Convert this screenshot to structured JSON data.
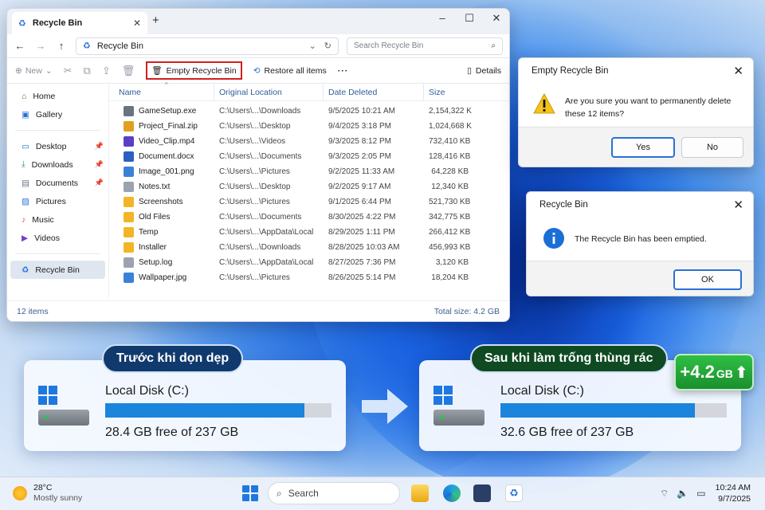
{
  "explorer": {
    "tab_title": "Recycle Bin",
    "address": "Recycle Bin",
    "search_placeholder": "Search Recycle Bin",
    "toolbar": {
      "new_label": "New",
      "empty_label": "Empty Recycle Bin",
      "restore_label": "Restore all items",
      "more_label": "···",
      "details_label": "Details"
    },
    "sidebar": [
      {
        "label": "Home",
        "icon": "home-icon"
      },
      {
        "label": "Gallery",
        "icon": "gallery-icon"
      },
      {
        "label": "Desktop",
        "icon": "desktop-icon"
      },
      {
        "label": "Downloads",
        "icon": "download-icon"
      },
      {
        "label": "Documents",
        "icon": "documents-icon"
      },
      {
        "label": "Pictures",
        "icon": "pictures-icon"
      },
      {
        "label": "Music",
        "icon": "music-icon"
      },
      {
        "label": "Videos",
        "icon": "videos-icon"
      },
      {
        "label": "Recycle Bin",
        "icon": "recycle-bin-icon"
      }
    ],
    "columns": [
      "Name",
      "Original Location",
      "Date Deleted",
      "Size"
    ],
    "files": [
      {
        "name": "GameSetup.exe",
        "loc": "C:\\Users\\...\\Downloads",
        "date": "9/5/2025 10:21 AM",
        "size": "2,154,322 KB",
        "color": "#6b7280"
      },
      {
        "name": "Project_Final.zip",
        "loc": "C:\\Users\\...\\Desktop",
        "date": "9/4/2025 3:18 PM",
        "size": "1,024,668 KB",
        "color": "#e0a020"
      },
      {
        "name": "Video_Clip.mp4",
        "loc": "C:\\Users\\...\\Videos",
        "date": "9/3/2025 8:12 PM",
        "size": "732,410 KB",
        "color": "#5b3fc4"
      },
      {
        "name": "Document.docx",
        "loc": "C:\\Users\\...\\Documents",
        "date": "9/3/2025 2:05 PM",
        "size": "128,416 KB",
        "color": "#2b5fc2"
      },
      {
        "name": "Image_001.png",
        "loc": "C:\\Users\\...\\Pictures",
        "date": "9/2/2025 11:33 AM",
        "size": "64,228 KB",
        "color": "#3b82d6"
      },
      {
        "name": "Notes.txt",
        "loc": "C:\\Users\\...\\Desktop",
        "date": "9/2/2025 9:17 AM",
        "size": "12,340 KB",
        "color": "#9ca3af"
      },
      {
        "name": "Screenshots",
        "loc": "C:\\Users\\...\\Pictures",
        "date": "9/1/2025 6:44 PM",
        "size": "521,730 KB",
        "color": "#f2b526"
      },
      {
        "name": "Old Files",
        "loc": "C:\\Users\\...\\Documents",
        "date": "8/30/2025 4:22 PM",
        "size": "342,775 KB",
        "color": "#f2b526"
      },
      {
        "name": "Temp",
        "loc": "C:\\Users\\...\\AppData\\Local",
        "date": "8/29/2025 1:11 PM",
        "size": "266,412 KB",
        "color": "#f2b526"
      },
      {
        "name": "Installer",
        "loc": "C:\\Users\\...\\Downloads",
        "date": "8/28/2025 10:03 AM",
        "size": "456,993 KB",
        "color": "#f2b526"
      },
      {
        "name": "Setup.log",
        "loc": "C:\\Users\\...\\AppData\\Local",
        "date": "8/27/2025 7:36 PM",
        "size": "3,120 KB",
        "color": "#9ca3af"
      },
      {
        "name": "Wallpaper.jpg",
        "loc": "C:\\Users\\...\\Pictures",
        "date": "8/26/2025 5:14 PM",
        "size": "18,204 KB",
        "color": "#3b82d6"
      }
    ],
    "status_items": "12 items",
    "status_total": "Total size: 4.2 GB"
  },
  "confirm_dialog": {
    "title": "Empty Recycle Bin",
    "message_line1": "Are you sure you want to permanently delete",
    "message_line2": "these 12 items?",
    "yes_label": "Yes",
    "no_label": "No"
  },
  "info_dialog": {
    "title": "Recycle Bin",
    "message": "The Recycle Bin has been emptied.",
    "ok_label": "OK"
  },
  "before": {
    "pill": "Trước khi dọn dẹp",
    "disk_name": "Local Disk (C:)",
    "free_text": "28.4 GB free of 237 GB",
    "used_fraction": 0.88
  },
  "after": {
    "pill": "Sau khi làm trống thùng rác",
    "disk_name": "Local Disk (C:)",
    "free_text": "32.6 GB free of 237 GB",
    "used_fraction": 0.86,
    "gain_value": "+4.2",
    "gain_unit": "GB"
  },
  "taskbar": {
    "temp": "28°C",
    "weather": "Mostly sunny",
    "search_label": "Search",
    "time": "10:24 AM",
    "date": "9/7/2025"
  }
}
